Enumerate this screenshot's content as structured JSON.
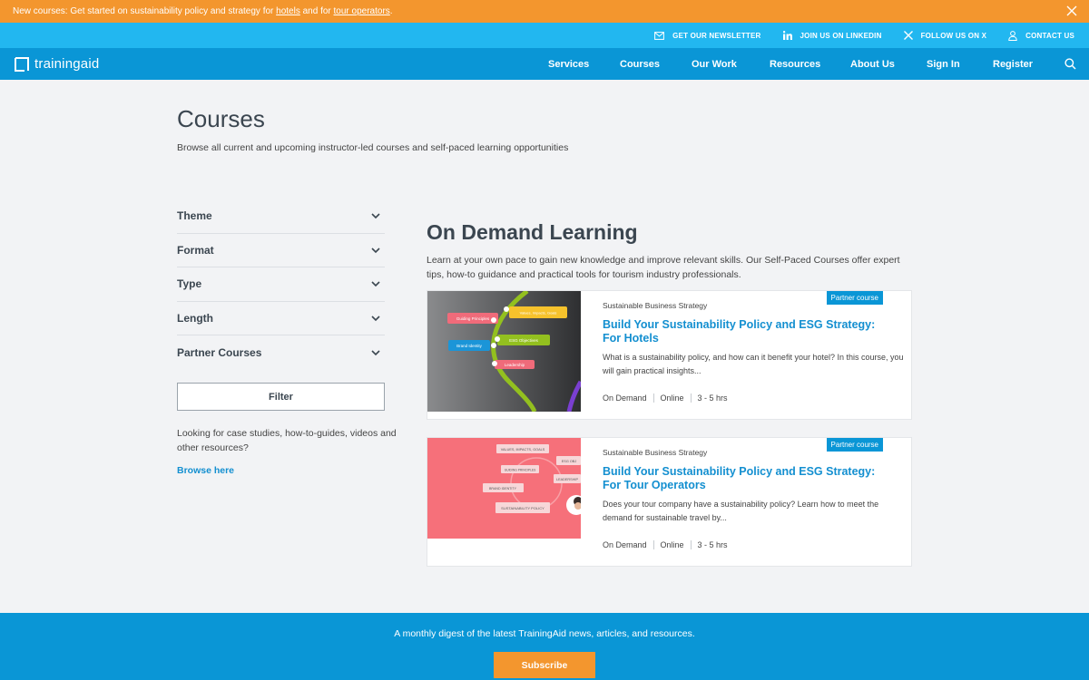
{
  "announcement": {
    "text_prefix": "New courses: Get started on sustainability policy and strategy for ",
    "link1": "hotels",
    "text_mid": " and for ",
    "link2": "tour operators",
    "text_suffix": "."
  },
  "utility": {
    "newsletter": "GET OUR NEWSLETTER",
    "linkedin": "JOIN US ON LINKEDIN",
    "x": "FOLLOW US ON X",
    "contact": "CONTACT US"
  },
  "nav": {
    "logo": "trainingaid",
    "services": "Services",
    "courses": "Courses",
    "our_work": "Our Work",
    "resources": "Resources",
    "about": "About Us",
    "sign_in": "Sign In",
    "register": "Register"
  },
  "page": {
    "title": "Courses",
    "subtitle": "Browse all current and upcoming instructor-led courses and self-paced learning opportunities"
  },
  "filters": {
    "items": [
      "Theme",
      "Format",
      "Type",
      "Length",
      "Partner Courses"
    ],
    "button": "Filter",
    "help": "Looking for case studies, how-to-guides, videos and other resources?",
    "browse": "Browse here"
  },
  "section": {
    "title": "On Demand Learning",
    "desc": "Learn at your own pace to gain new knowledge and improve relevant skills. Our Self-Paced Courses offer expert tips, how-to guidance and practical tools for tourism industry professionals."
  },
  "cards": [
    {
      "badge": "Partner course",
      "category": "Sustainable Business Strategy",
      "title": "Build Your Sustainability Policy and ESG Strategy: For Hotels",
      "desc": "What is a sustainability policy, and how can it benefit your hotel? In this course, you will gain practical insights...",
      "format": "On Demand",
      "location": "Online",
      "length": "3 - 5 hrs"
    },
    {
      "badge": "Partner course",
      "category": "Sustainable Business Strategy",
      "title": "Build Your Sustainability Policy and ESG Strategy: For Tour Operators",
      "desc": "Does your tour company have a sustainability policy? Learn how to meet the demand for sustainable travel by...",
      "format": "On Demand",
      "location": "Online",
      "length": "3 - 5 hrs"
    }
  ],
  "thumb1": {
    "labels": [
      "Guiding Principles",
      "Values, Impacts, Goals",
      "ESG Objectives",
      "Brand Identity",
      "Leadership"
    ]
  },
  "thumb2": {
    "labels": [
      "VALUES, IMPACTS, GOALS",
      "ESG OBJ",
      "GUIDING PRINCIPLES",
      "LEADERSHIP",
      "BRAND IDENTITY",
      "SUSTAINABILITY POLICY"
    ]
  },
  "footer": {
    "text": "A monthly digest of the latest TrainingAid news, articles, and resources.",
    "subscribe": "Subscribe"
  },
  "colors": {
    "orange": "#f3962e",
    "light_blue": "#22b7f0",
    "blue": "#0a96d6",
    "link": "#138fd0"
  }
}
